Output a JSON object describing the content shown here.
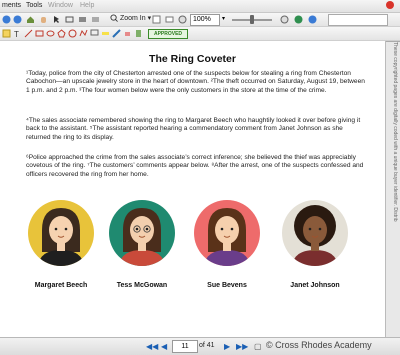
{
  "menu": {
    "items": [
      "ments",
      "Tools",
      "Window",
      "Help"
    ]
  },
  "toolbar": {
    "zoom_in_label": "Zoom In",
    "zoom_value": "100%",
    "stamp_label": "APPROVED"
  },
  "document": {
    "title": "The Ring Coveter",
    "paragraphs": [
      "¹Today, police from the city of Chesterton arrested one of the suspects below for stealing a ring from Chesterton Cabochon—an upscale jewelry store in the heart of downtown.  ²The theft occurred on Saturday, August 19, between 1 p.m. and 2 p.m.  ³The four women below were the only customers in the store at the time of the crime.",
      "⁴The sales associate remembered showing the ring to Margaret Beech who haughtily looked it over before giving it back to the assistant.  ⁵The assistant reported hearing a commendatory comment from Janet Johnson as she returned the ring to its display.",
      "⁶Police approached the crime from the sales associate’s correct inference; she believed the thief was appreciably covetous of the ring.  ⁷The customers’ comments appear below.  ⁸After the arrest, one of the suspects confessed and officers recovered the ring from her home."
    ],
    "side_note": "These copyrighted pages are digitally coded with a unique buyer identifier. Distrib",
    "suspects": [
      {
        "name": "Margaret Beech",
        "bg": "#e8c33a",
        "hair": "#3b2a1e",
        "skin": "#f6d2b0",
        "shirt": "#1f1f1f"
      },
      {
        "name": "Tess McGowan",
        "bg": "#1f8a70",
        "hair": "#4a2d1c",
        "skin": "#f3cfae",
        "shirt": "#c94a3a"
      },
      {
        "name": "Sue Bevens",
        "bg": "#ee6b6b",
        "hair": "#5a3219",
        "skin": "#f6d0ad",
        "shirt": "#6a3d8a"
      },
      {
        "name": "Janet Johnson",
        "bg": "#e4e0d6",
        "hair": "#2a1a10",
        "skin": "#8a5a3a",
        "shirt": "#7a2e2e"
      }
    ]
  },
  "nav": {
    "current_page": "11",
    "of_label": "of 41"
  },
  "watermark": "© Cross Rhodes Academy"
}
